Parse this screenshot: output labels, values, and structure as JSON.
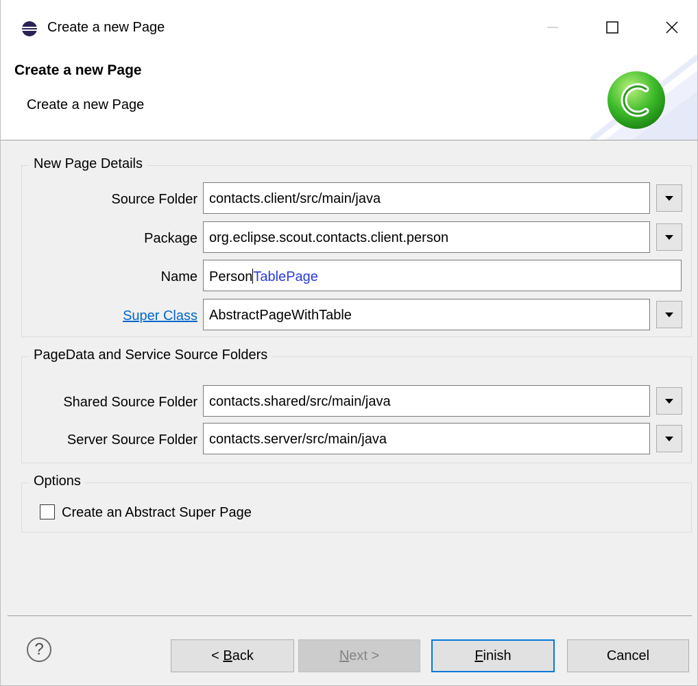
{
  "window": {
    "title": "Create a new Page"
  },
  "banner": {
    "title": "Create a new Page",
    "description": "Create a new Page"
  },
  "details": {
    "group_title": "New Page Details",
    "source_folder": {
      "label": "Source Folder",
      "value": "contacts.client/src/main/java"
    },
    "package": {
      "label": "Package",
      "value": "org.eclipse.scout.contacts.client.person"
    },
    "name": {
      "label": "Name",
      "value_before_caret": "Person",
      "value_selected": "TablePage"
    },
    "super_class": {
      "label": "Super Class",
      "value": "AbstractPageWithTable"
    }
  },
  "pagedata": {
    "group_title": "PageData and Service Source Folders",
    "shared": {
      "label": "Shared Source Folder",
      "value": "contacts.shared/src/main/java"
    },
    "server": {
      "label": "Server Source Folder",
      "value": "contacts.server/src/main/java"
    }
  },
  "options": {
    "group_title": "Options",
    "abstract_super_page": {
      "label": "Create an Abstract Super Page",
      "checked": false
    }
  },
  "buttons": {
    "help": "?",
    "back_prefix": "< ",
    "back_mnemonic": "B",
    "back_rest": "ack",
    "next_mnemonic": "N",
    "next_rest": "ext >",
    "finish_mnemonic": "F",
    "finish_rest": "inish",
    "cancel": "Cancel"
  },
  "icons": {
    "app": "eclipse-icon",
    "logo": "scout-c-logo-icon",
    "minimize": "minimize-icon",
    "maximize": "maximize-icon",
    "close": "close-icon",
    "help": "help-icon",
    "dropdown": "chevron-down-icon"
  },
  "colors": {
    "link": "#0066cc",
    "selection_text": "#2a3bd6",
    "focus_border": "#0078d7",
    "logo_green": "#3dbb2a"
  }
}
